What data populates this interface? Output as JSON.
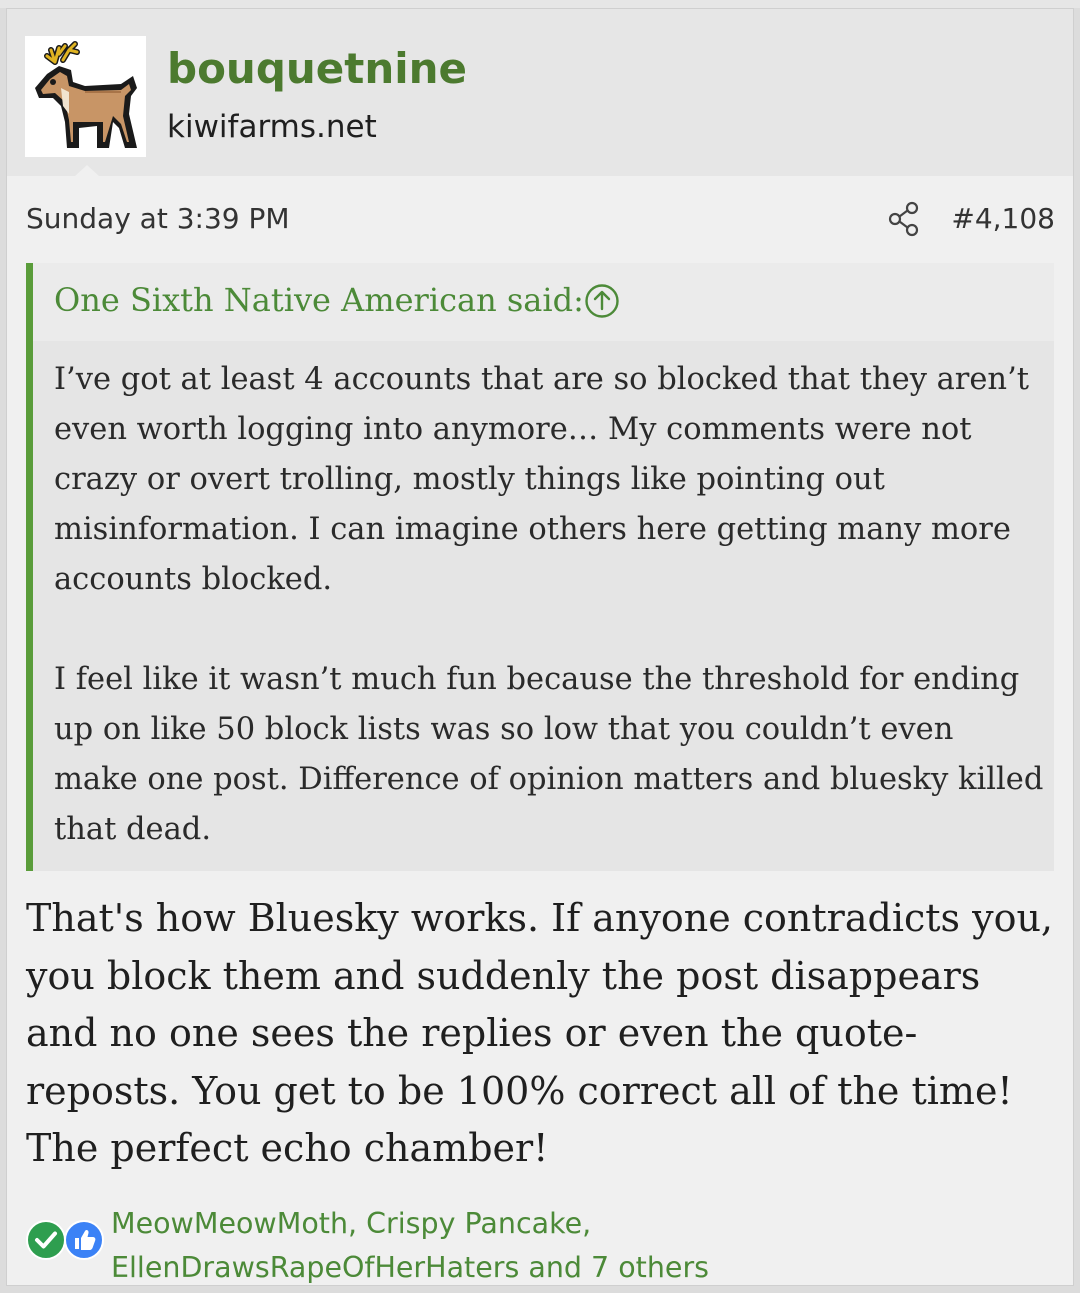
{
  "user": {
    "name": "bouquetnine",
    "title": "kiwifarms.net",
    "avatar_icon": "deer-icon"
  },
  "post": {
    "date": "Sunday at 3:39 PM",
    "number": "#4,108",
    "share_icon": "share-icon"
  },
  "quote": {
    "author_label": "One Sixth Native American said:",
    "expand_icon": "arrow-up-circle-icon",
    "paragraphs": [
      "I’ve got at least 4 accounts that are so blocked that they aren’t even worth logging into anymore… My comments were not crazy or overt trolling, mostly things like pointing out misinformation. I can imagine others here getting many more accounts blocked.",
      "I feel like it wasn’t much fun because the threshold for ending up on like 50 block lists was so low that you couldn’t even make one post. Difference of opinion matters and bluesky killed that dead."
    ]
  },
  "message": {
    "text": "That's how Bluesky works. If anyone contradicts you, you block them and suddenly the post disappears and no one sees the replies or even the quote-reposts. You get to be 100% correct all of the time! The perfect echo chamber!"
  },
  "reactions": {
    "icons": [
      "agree-check-icon",
      "like-thumb-icon"
    ],
    "line1": "MeowMeowMoth, Crispy Pancake,",
    "line2": "EllenDrawsRapeOfHerHaters and 7 others"
  },
  "colors": {
    "accent_green": "#4c7a2f",
    "quote_border": "#5a9c3a",
    "like_blue": "#3b82f6",
    "agree_green": "#2e9e4f"
  }
}
